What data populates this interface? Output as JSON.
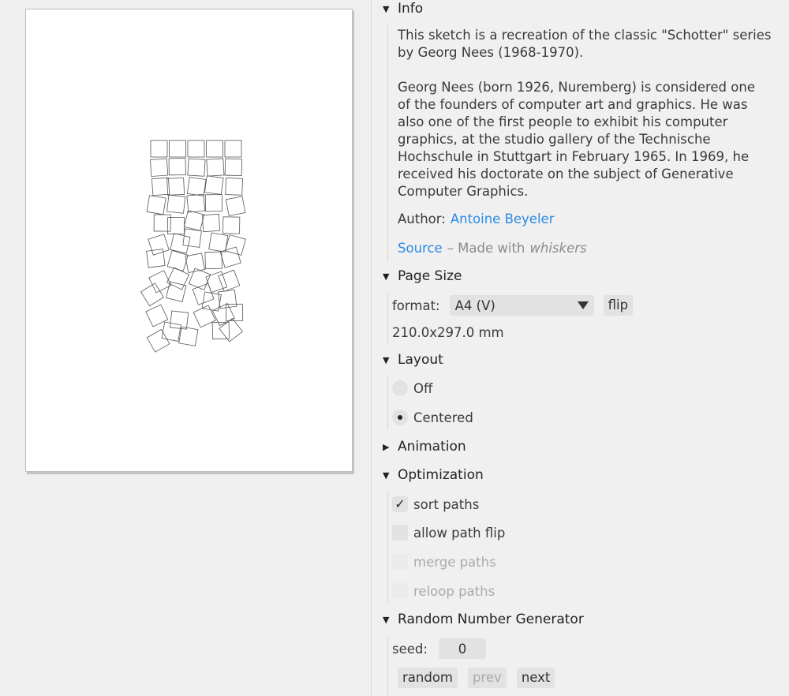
{
  "info": {
    "title": "Info",
    "description_1_line1": "This sketch is a recreation of the classic \"Schotter\" series",
    "description_1_line2": "by Georg Nees (1968-1970).",
    "description_2_lines": [
      "Georg Nees (born 1926, Nuremberg) is considered one",
      "of the founders of computer art and graphics. He was",
      "also one of the first people to exhibit his computer",
      "graphics, at the studio gallery of the Technische",
      "Hochschule in Stuttgart in February 1965. In 1969, he",
      "received his doctorate on the subject of Generative",
      "Computer Graphics."
    ],
    "author_label": "Author:",
    "author_name": "Antoine Beyeler",
    "source_link": "Source",
    "made_with_prefix": "– Made with",
    "made_with_name": "whiskers"
  },
  "page_size": {
    "title": "Page Size",
    "format_label": "format:",
    "format_value": "A4 (V)",
    "flip_label": "flip",
    "dimensions": "210.0x297.0 mm"
  },
  "layout": {
    "title": "Layout",
    "options": [
      "Off",
      "Centered"
    ],
    "selected": "Centered"
  },
  "animation": {
    "title": "Animation"
  },
  "optimization": {
    "title": "Optimization",
    "options": [
      {
        "label": "sort paths",
        "checked": true,
        "enabled": true
      },
      {
        "label": "allow path flip",
        "checked": false,
        "enabled": true
      },
      {
        "label": "merge paths",
        "checked": false,
        "enabled": false
      },
      {
        "label": "reloop paths",
        "checked": false,
        "enabled": false
      }
    ]
  },
  "rng": {
    "title": "Random Number Generator",
    "seed_label": "seed:",
    "seed_value": "0",
    "random_label": "random",
    "prev_label": "prev",
    "next_label": "next"
  },
  "icons": {
    "expanded": "triangle-down-icon",
    "collapsed": "triangle-right-icon",
    "checkmark": "check-icon"
  }
}
